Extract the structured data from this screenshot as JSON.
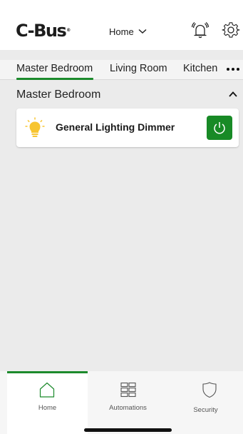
{
  "header": {
    "logo_text": "C-Bus",
    "logo_mark": "®",
    "home_selector": "Home",
    "icons": {
      "alarm": "alarm-bell-icon",
      "settings": "gear-icon",
      "dropdown": "chevron-down-icon"
    }
  },
  "tabs": {
    "items": [
      {
        "label": "Master Bedroom",
        "selected": true
      },
      {
        "label": "Living Room",
        "selected": false
      },
      {
        "label": "Kitchen",
        "selected": false
      }
    ],
    "more_icon": "more-dots-icon"
  },
  "section": {
    "title": "Master Bedroom",
    "collapse_icon": "chevron-up-icon",
    "devices": [
      {
        "label": "General Lighting Dimmer",
        "icon": "lightbulb-icon",
        "state": "on"
      }
    ]
  },
  "bottom_nav": {
    "items": [
      {
        "label": "Home",
        "icon": "home-icon",
        "selected": true
      },
      {
        "label": "Automations",
        "icon": "grid-icon",
        "selected": false
      },
      {
        "label": "Security",
        "icon": "shield-icon",
        "selected": false
      }
    ]
  },
  "colors": {
    "accent": "#1c8a2c",
    "power_on": "#188a26",
    "bulb": "#f7c531",
    "background": "#ebebeb"
  }
}
